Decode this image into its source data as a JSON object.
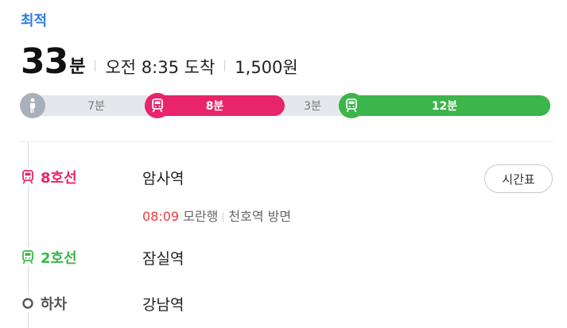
{
  "header": {
    "label": "최적"
  },
  "summary": {
    "duration_value": "33",
    "duration_unit": "분",
    "arrival": "오전 8:35 도착",
    "fare": "1,500원"
  },
  "segments": {
    "walk": {
      "label": "7분",
      "icon": "walk-icon"
    },
    "line8": {
      "label": "8분",
      "icon": "train-icon",
      "color": "#e8246b"
    },
    "transfer": {
      "label": "3분"
    },
    "line2": {
      "label": "12분",
      "icon": "train-icon",
      "color": "#3cb54a"
    }
  },
  "legs": [
    {
      "line": "8호선",
      "color": "#e8246b",
      "icon": "train-icon",
      "station": "암사역",
      "detail": {
        "time": "08:09",
        "direction": "모란행",
        "platform": "천호역 방면"
      }
    },
    {
      "line": "2호선",
      "color": "#3cb54a",
      "icon": "train-icon",
      "station": "잠실역"
    },
    {
      "line": "하차",
      "color": "#555555",
      "icon": "circle-icon",
      "station": "강남역"
    }
  ],
  "timetable_button": {
    "label": "시간표"
  }
}
